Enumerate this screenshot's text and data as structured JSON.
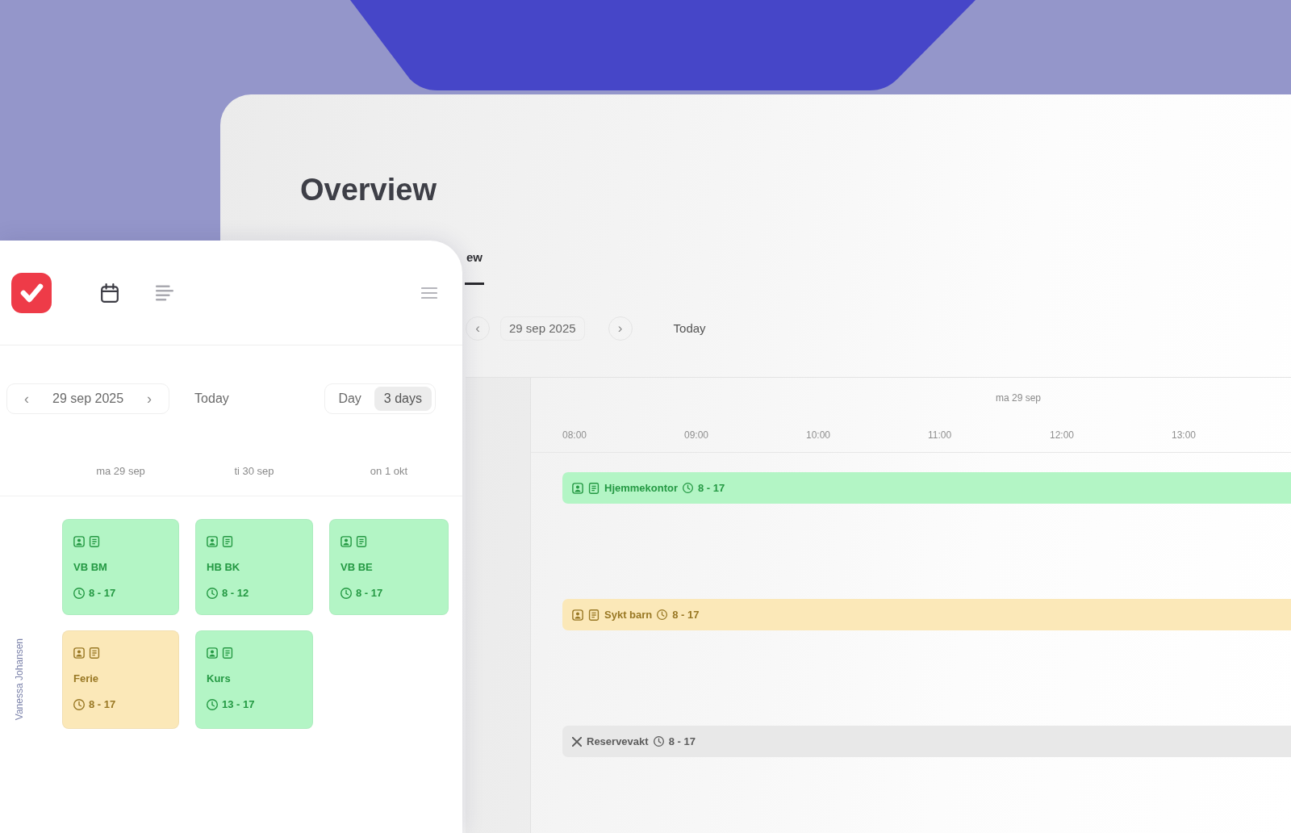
{
  "overview_window": {
    "title": "Overview",
    "tabs": [
      {
        "label": "ew",
        "selected": true
      }
    ],
    "toolbar": {
      "previous": "‹",
      "date": "29 sep 2025",
      "next": "›",
      "today": "Today"
    },
    "day": "ma 29 sep",
    "time_ticks": [
      "08:00",
      "09:00",
      "10:00",
      "11:00",
      "12:00",
      "13:00"
    ],
    "rows": [
      {
        "kind": "shift",
        "title": "Hjemmekontor",
        "time": "8 - 17",
        "color": "#b3f5c5"
      },
      {
        "kind": "shift",
        "title": "Sykt barn",
        "time": "8 - 17",
        "color": "#fbe8b8"
      },
      {
        "kind": "standby",
        "title": "Reservevakt",
        "time": "8 - 17",
        "color": "#e8e8e8"
      }
    ]
  },
  "app_panel": {
    "nav": [
      {
        "kind": "calendar",
        "selected": true
      },
      {
        "kind": "list",
        "selected": false
      }
    ],
    "toolbar": {
      "previous": "‹",
      "date": "29 sep 2025",
      "next": "›",
      "today": "Today",
      "views": [
        {
          "label": "Day",
          "selected": false
        },
        {
          "label": "3 days",
          "selected": true
        }
      ]
    },
    "columns": [
      "ma 29 sep",
      "ti 30 sep",
      "on 1 okt"
    ],
    "person": "Vanessa Johansen",
    "rows": [
      {
        "cells": [
          {
            "code": "VB BM",
            "time": "8 - 17",
            "color": "#b3f5c5"
          },
          {
            "code": "HB BK",
            "time": "8 - 12",
            "color": "#b3f5c5"
          },
          {
            "code": "VB BE",
            "time": "8 - 17",
            "color": "#b3f5c5"
          }
        ]
      },
      {
        "cells": [
          {
            "code": "Ferie",
            "time": "8 - 17",
            "color": "#fbe8b8"
          },
          {
            "code": "Kurs",
            "time": "13 - 17",
            "color": "#b3f5c5"
          }
        ]
      }
    ]
  }
}
